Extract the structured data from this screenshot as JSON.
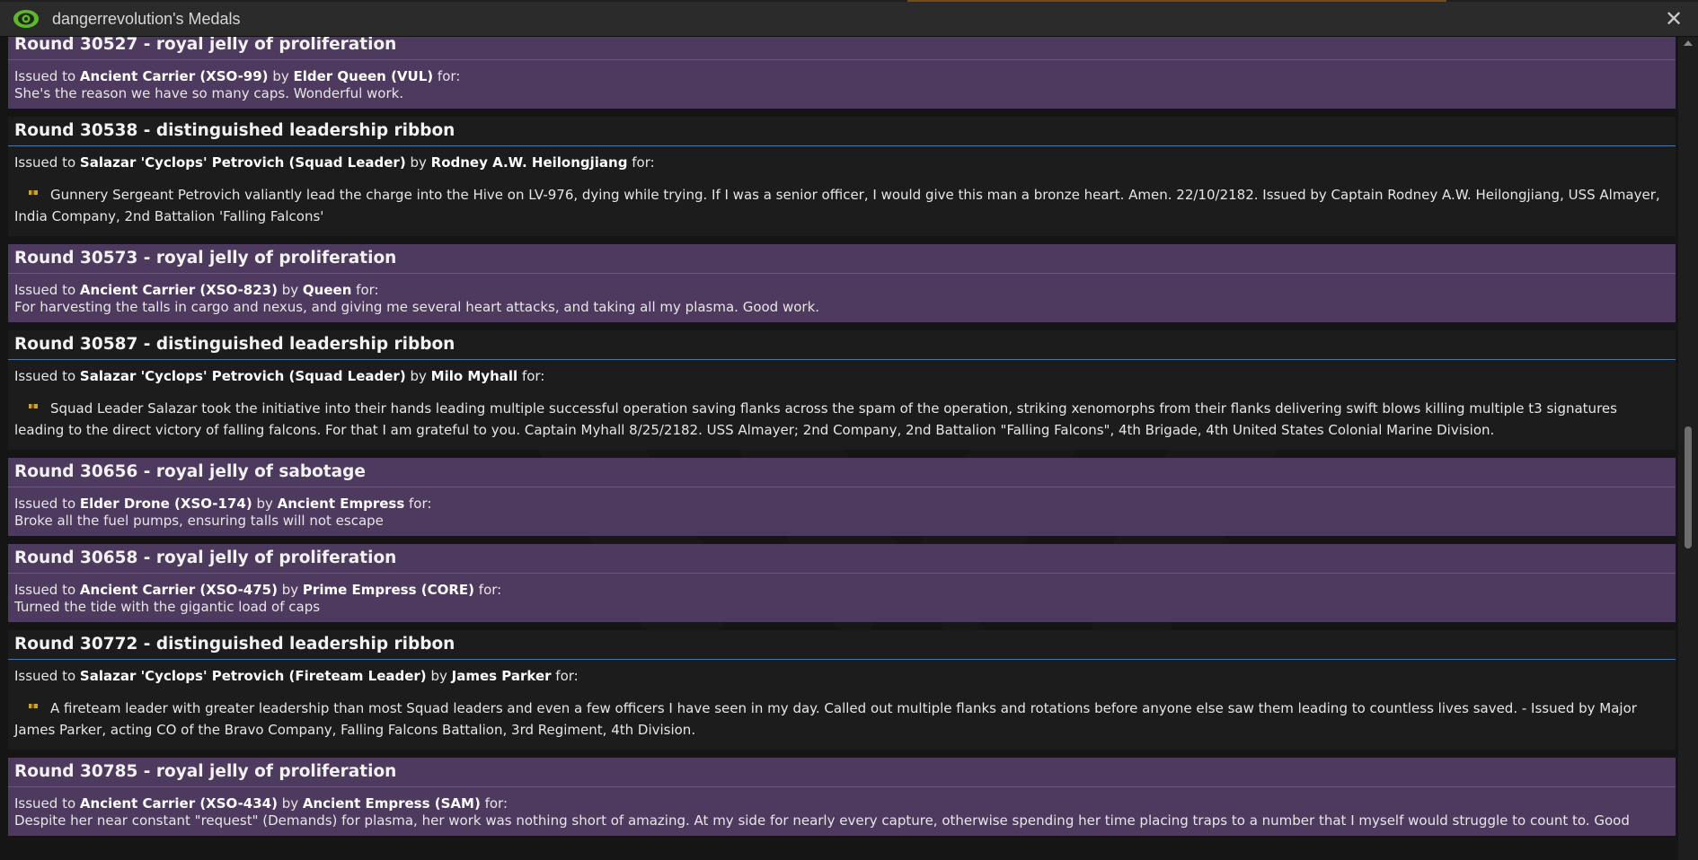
{
  "window": {
    "title": "dangerrevolution's Medals",
    "icon": "eye-icon",
    "close_icon": "close-icon"
  },
  "colors": {
    "xeno_medal_bg": "#4f3a5f",
    "marine_medal_bg": "#1c1c1c",
    "marine_header_rule": "#4a78a8",
    "eye_icon_green": "#5fb82c"
  },
  "medals": [
    {
      "header": "Round 30527 - royal jelly of proliferation",
      "issued_prefix": "Issued to ",
      "recipient": "Ancient Carrier (XSO-99)",
      "by": " by ",
      "issuer": "Elder Queen (VUL)",
      "for": " for:",
      "citation": "She's the reason we have so many caps. Wonderful work."
    },
    {
      "header": "Round 30538 - distinguished leadership ribbon",
      "issued_prefix": "Issued to ",
      "recipient": "Salazar 'Cyclops' Petrovich (Squad Leader)",
      "by": " by ",
      "issuer": "Rodney A.W. Heilongjiang",
      "for": " for:",
      "citation": "Gunnery Sergeant Petrovich valiantly lead the charge into the Hive on LV-976, dying while trying. If I was a senior officer, I would give this man a bronze heart. Amen. 22/10/2182. Issued by Captain Rodney A.W. Heilongjiang, USS Almayer, India Company, 2nd Battalion 'Falling Falcons'"
    },
    {
      "header": "Round 30573 - royal jelly of proliferation",
      "issued_prefix": "Issued to ",
      "recipient": "Ancient Carrier (XSO-823)",
      "by": " by ",
      "issuer": "Queen",
      "for": " for:",
      "citation": "For harvesting the talls in cargo and nexus, and giving me several heart attacks, and taking all my plasma. Good work."
    },
    {
      "header": "Round 30587 - distinguished leadership ribbon",
      "issued_prefix": "Issued to ",
      "recipient": "Salazar 'Cyclops' Petrovich (Squad Leader)",
      "by": " by ",
      "issuer": "Milo Myhall",
      "for": " for:",
      "citation": "Squad Leader Salazar took the initiative into their hands leading multiple successful operation saving flanks across the spam of the operation, striking xenomorphs from their flanks delivering swift blows killing multiple t3 signatures leading to the direct victory of falling falcons. For that I am grateful to you. Captain Myhall 8/25/2182. USS Almayer; 2nd Company, 2nd Battalion \"Falling Falcons\", 4th Brigade, 4th United States Colonial Marine Division."
    },
    {
      "header": "Round 30656 - royal jelly of sabotage",
      "issued_prefix": "Issued to ",
      "recipient": "Elder Drone (XSO-174)",
      "by": " by ",
      "issuer": "Ancient Empress",
      "for": " for:",
      "citation": "Broke all the fuel pumps, ensuring talls will not escape"
    },
    {
      "header": "Round 30658 - royal jelly of proliferation",
      "issued_prefix": "Issued to ",
      "recipient": "Ancient Carrier (XSO-475)",
      "by": " by ",
      "issuer": "Prime Empress (CORE)",
      "for": " for:",
      "citation": "Turned the tide with the gigantic load of caps"
    },
    {
      "header": "Round 30772 - distinguished leadership ribbon",
      "issued_prefix": "Issued to ",
      "recipient": "Salazar 'Cyclops' Petrovich (Fireteam Leader)",
      "by": " by ",
      "issuer": "James Parker",
      "for": " for:",
      "citation": "A fireteam leader with greater leadership than most Squad leaders and even a few officers I have seen in my day. Called out multiple flanks and rotations before anyone else saw them leading to countless lives saved. - Issued by Major James Parker, acting CO of the Bravo Company, Falling Falcons Battalion, 3rd Regiment, 4th Division."
    },
    {
      "header": "Round 30785 - royal jelly of proliferation",
      "issued_prefix": "Issued to ",
      "recipient": "Ancient Carrier (XSO-434)",
      "by": " by ",
      "issuer": "Ancient Empress (SAM)",
      "for": " for:",
      "citation": "Despite her near constant \"request\" (Demands) for plasma, her work was nothing short of amazing. At my side for nearly every capture, otherwise spending her time placing traps to a number that I myself would struggle to count to. Good"
    }
  ]
}
